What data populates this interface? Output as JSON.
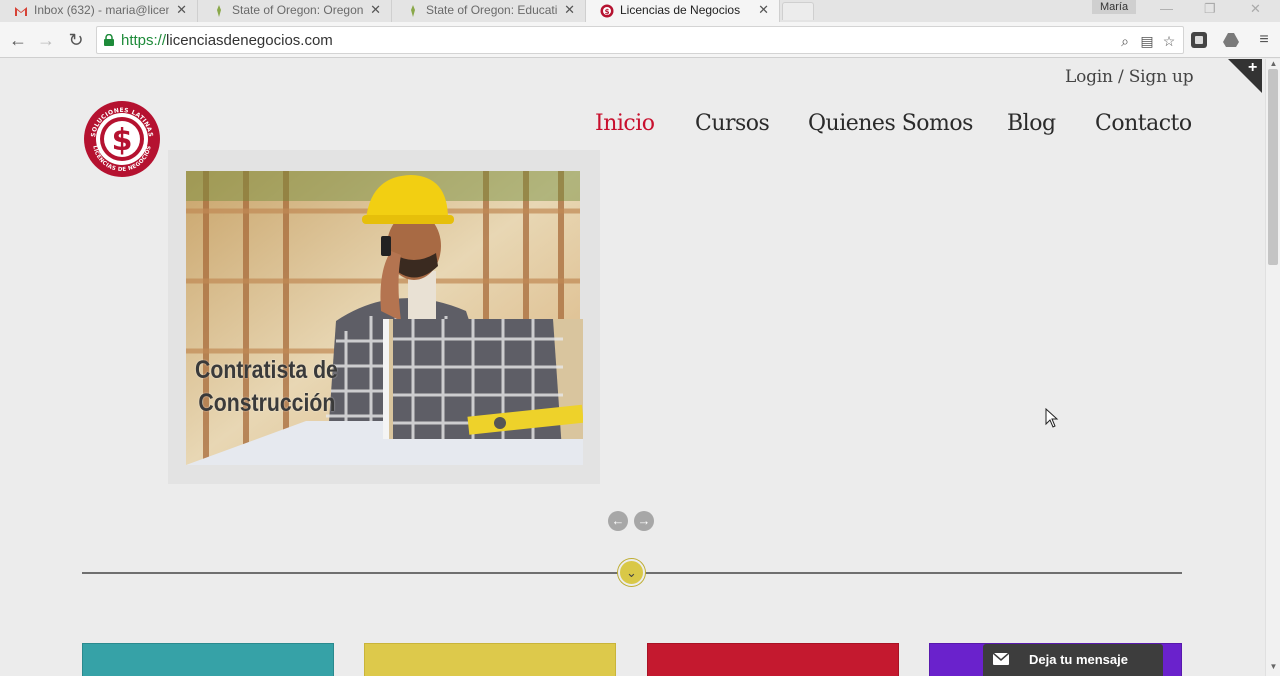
{
  "browser": {
    "tabs": [
      {
        "label": "Inbox (632) - maria@licen",
        "icon": "gmail-icon",
        "active": false
      },
      {
        "label": "State of Oregon: Oregon",
        "icon": "oregon-icon",
        "active": false
      },
      {
        "label": "State of Oregon: Educati",
        "icon": "oregon-icon",
        "active": false
      },
      {
        "label": "Licencias de Negocios",
        "icon": "site-logo-icon",
        "active": true
      }
    ],
    "user_badge": "María",
    "url_scheme": "https://",
    "url_host": "licenciasdenegocios.com",
    "icons": [
      "back-icon",
      "forward-icon",
      "reload-icon",
      "lock-icon",
      "zoom-icon",
      "translate-icon",
      "bookmark-star-icon",
      "extension-icon",
      "drive-icon",
      "menu-icon"
    ]
  },
  "header": {
    "login_label": "Login / Sign up",
    "nav": [
      {
        "label": "Inicio",
        "active": true
      },
      {
        "label": "Cursos",
        "active": false
      },
      {
        "label": "Quienes Somos",
        "active": false
      },
      {
        "label": "Blog",
        "active": false
      },
      {
        "label": "Contacto",
        "active": false
      }
    ],
    "logo_text_top": "SOLUCIONES LATINAS",
    "logo_text_bottom": "LICENCIAS DE NEGOCIOS",
    "corner_symbol": "+"
  },
  "slider": {
    "title_line1": "Contratista de",
    "title_line2": "Construcción",
    "prev_symbol": "←",
    "next_symbol": "→"
  },
  "divider": {
    "toggle_symbol": "⌄"
  },
  "cards": [
    {
      "color": "#36a2a7"
    },
    {
      "color": "#ddc94b"
    },
    {
      "color": "#c4192f"
    },
    {
      "color": "#6a22cc"
    }
  ],
  "chat": {
    "label": "Deja tu mensaje"
  },
  "colors": {
    "accent": "#c8102e",
    "background": "#ececec"
  }
}
